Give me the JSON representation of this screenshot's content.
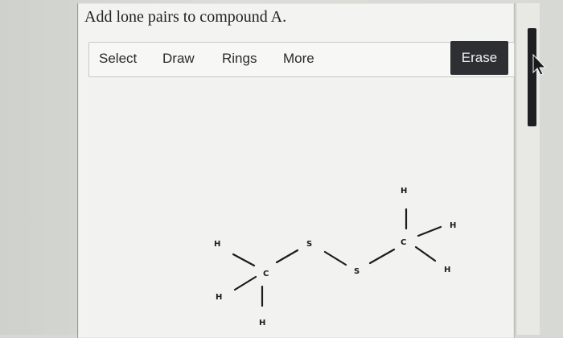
{
  "question": "Add lone pairs to compound A.",
  "toolbar": {
    "select": "Select",
    "draw": "Draw",
    "rings": "Rings",
    "more": "More",
    "erase": "Erase"
  },
  "molecule": {
    "atoms": {
      "h_left_top": "H",
      "h_left_bottom": "H",
      "h_bottom": "H",
      "c_left": "C",
      "s_first": "S",
      "s_second": "S",
      "c_right": "C",
      "h_top": "H",
      "h_right_top": "H",
      "h_right_bottom": "H"
    }
  }
}
